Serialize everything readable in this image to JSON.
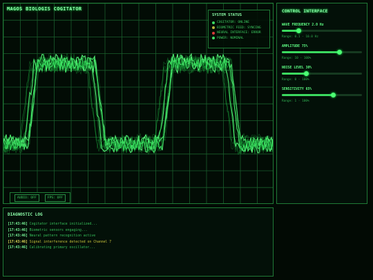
{
  "scope": {
    "title": "MAGOS BIOLOGIS COGITATOR"
  },
  "status": {
    "title": "SYSTEM STATUS",
    "items": [
      {
        "label": "COGITATOR: ONLINE",
        "color": "#3bdc63"
      },
      {
        "label": "BIOMETRIC FEED: SYNCING",
        "color": "#b8b33a"
      },
      {
        "label": "NEURAL INTERFACE: ERROR",
        "color": "#d83a3a"
      },
      {
        "label": "POWER: NOMINAL",
        "color": "#3bdc63"
      }
    ]
  },
  "toggles": {
    "audio": "AUDIO: OFF",
    "fps": "FPS: OFF"
  },
  "control": {
    "title": "CONTROL INTERFACE",
    "sliders": [
      {
        "label": "WAVE FREQUENCY 2.0 Hz",
        "range": "Range: 0.1 - 10.0 Hz",
        "level": 0.21
      },
      {
        "label": "AMPLITUDE 75%",
        "range": "Range: 10 - 100%",
        "level": 0.72
      },
      {
        "label": "NOISE LEVEL 30%",
        "range": "Range: 0 - 100%",
        "level": 0.31
      },
      {
        "label": "SENSITIVITY 65%",
        "range": "Range: 1 - 100%",
        "level": 0.64
      }
    ]
  },
  "log": {
    "title": "DIAGNOSTIC LOG",
    "entries": [
      {
        "time": "[17:43:46]",
        "text": "Cogitator interface initialized...",
        "level": "info"
      },
      {
        "time": "[17:43:46]",
        "text": "Biometric sensors engaging...",
        "level": "info"
      },
      {
        "time": "[17:43:46]",
        "text": "Neural pattern recognition active",
        "level": "info"
      },
      {
        "time": "[17:43:46]",
        "text": "Signal interference detected on Channel 7",
        "level": "warn"
      },
      {
        "time": "[17:43:46]",
        "text": "Calibrating primary oscillator...",
        "level": "info"
      }
    ]
  },
  "colors": {
    "accent": "#39ff6a",
    "grid": "#1a5e2c",
    "warning": "#c9c33a",
    "error": "#d83a3a"
  }
}
